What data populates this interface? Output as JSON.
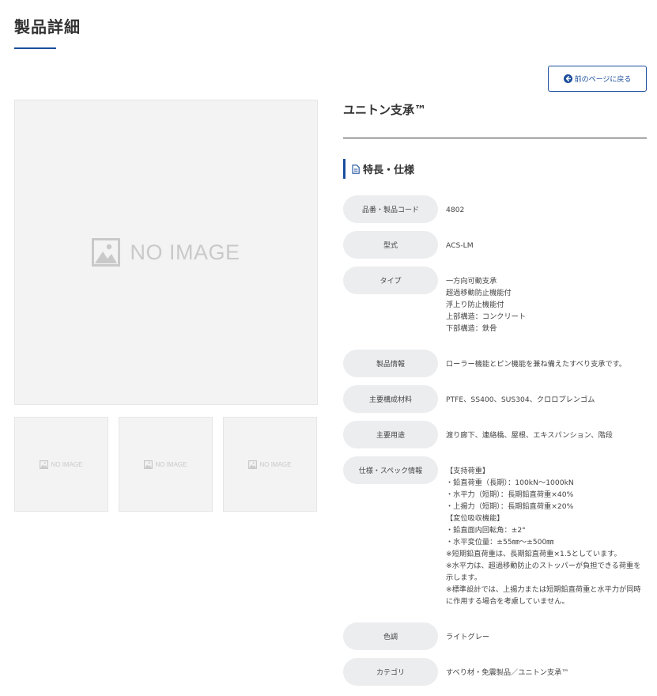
{
  "page": {
    "title": "製品詳細"
  },
  "back_button": {
    "label": "前のページに戻る",
    "icon": "circle-arrow-left-icon"
  },
  "gallery": {
    "main_placeholder": "NO IMAGE",
    "thumbnails": [
      "NO IMAGE",
      "NO IMAGE",
      "NO IMAGE"
    ]
  },
  "product": {
    "name": "ユニトン支承™"
  },
  "section": {
    "heading": "特長・仕様",
    "icon": "document-icon"
  },
  "specs": [
    {
      "label": "品番・製品コード",
      "value": "4802"
    },
    {
      "label": "型式",
      "value": "ACS-LM"
    },
    {
      "label": "タイプ",
      "value": "一方向可動支承\n超過移動防止機能付\n浮上り防止機能付\n上部構造：コンクリート\n下部構造：鉄骨"
    },
    {
      "label": "製品情報",
      "value": "ローラー機能とピン機能を兼ね備えたすべり支承です。"
    },
    {
      "label": "主要構成材料",
      "value": "PTFE、SS400、SUS304、クロロプレンゴム"
    },
    {
      "label": "主要用途",
      "value": "渡り廊下、連絡橋、屋根、エキスパンション、階段"
    },
    {
      "label": "仕様・スペック情報",
      "value": "【支持荷重】\n・鉛直荷重（長期）：100kN〜1000kN\n・水平力（短期）：長期鉛直荷重×40%\n・上揚力（短期）：長期鉛直荷重×20%\n【変位吸収機能】\n・鉛直面内回転角：±2°\n・水平変位量：±55㎜〜±500㎜\n※短期鉛直荷重は、長期鉛直荷重×1.5としています。\n※水平力は、超過移動防止のストッパーが負担できる荷重を示します。\n※標準設計では、上揚力または短期鉛直荷重と水平力が同時に作用する場合を考慮していません。"
    },
    {
      "label": "色調",
      "value": "ライトグレー"
    },
    {
      "label": "カテゴリ",
      "value": "すべり材・免震製品／ユニトン支承™"
    }
  ],
  "colors": {
    "accent": "#1a4e9c",
    "label_bg": "#ecedef",
    "placeholder_bg": "#f3f3f3"
  }
}
